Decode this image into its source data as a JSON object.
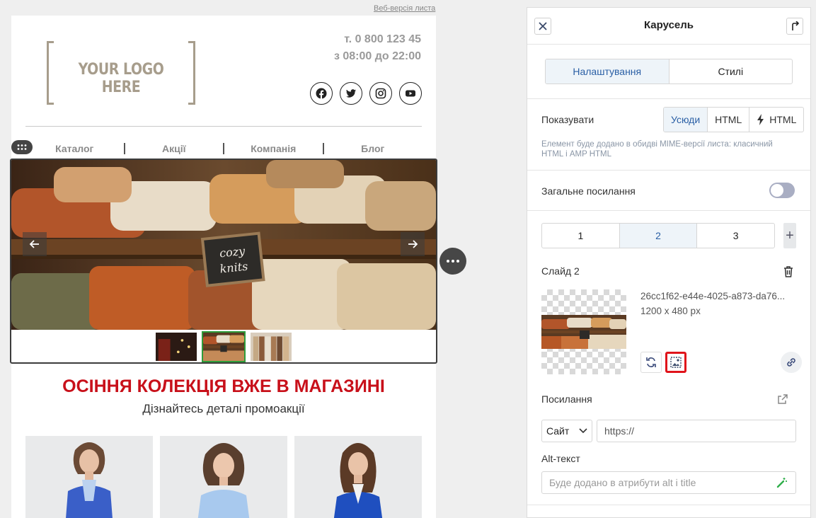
{
  "email": {
    "web_version_link": "Веб-версія листа",
    "logo_text": "YOUR LOGO HERE",
    "phone": "т. 0 800 123 45",
    "hours": "з 08:00 до 22:00",
    "socials": [
      "facebook-icon",
      "twitter-icon",
      "instagram-icon",
      "youtube-icon"
    ],
    "menu": [
      "Каталог",
      "Акції",
      "Компанія",
      "Блог"
    ],
    "sign_text_line1": "cozy",
    "sign_text_line2": "knits",
    "title": "ОСІННЯ КОЛЕКЦІЯ ВЖЕ В МАГАЗИНІ",
    "subtitle": "Дізнайтесь деталі промоакції",
    "title_color": "#c8101a",
    "active_thumb_color": "#2e9c3a"
  },
  "panel": {
    "title": "Карусель",
    "tabs": [
      "Налаштування",
      "Стилі"
    ],
    "show_label": "Показувати",
    "show_options": [
      "Усюди",
      "HTML",
      "HTML"
    ],
    "note": "Елемент буде додано в обидві MIME-версії листа: класичний HTML і AMP HTML",
    "general_link_label": "Загальне посилання",
    "slides": [
      "1",
      "2",
      "3"
    ],
    "plus": "+",
    "slide_label": "Слайд 2",
    "file_name": "26cc1f62-e44e-4025-a873-da76...",
    "file_size": "1200 x 480 px",
    "link_label": "Посилання",
    "link_type": "Сайт",
    "link_url": "https://",
    "alt_label": "Alt-текст",
    "alt_placeholder": "Буде додано в атрибути alt і title",
    "accent_color": "#2a5fa5",
    "highlight_color": "#e0141b"
  }
}
